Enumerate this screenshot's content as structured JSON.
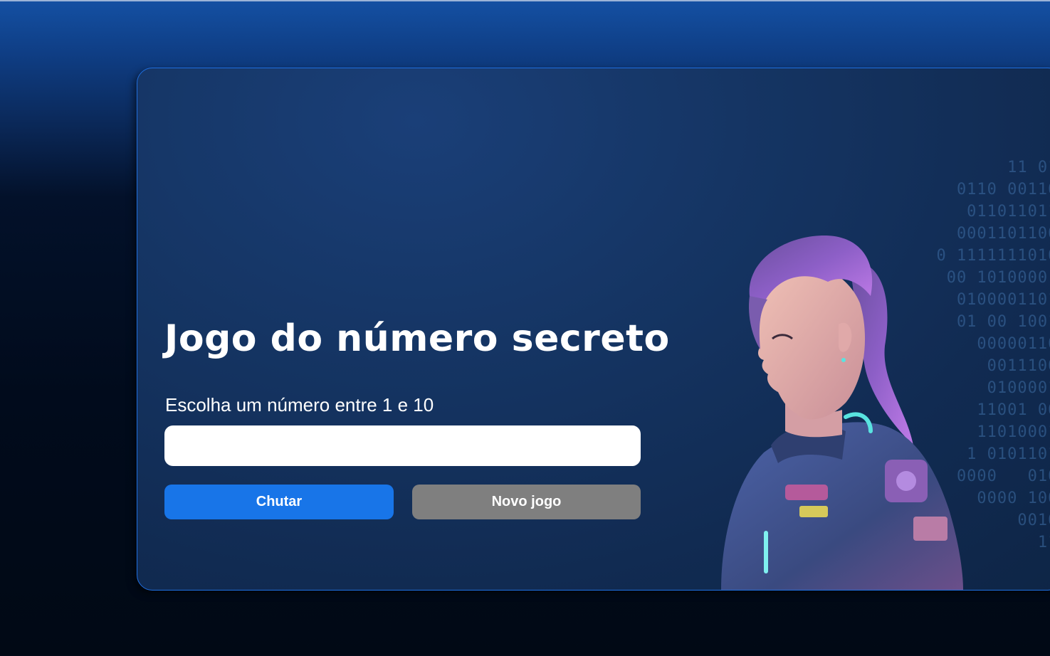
{
  "page": {
    "title": "Jogo do número secreto",
    "prompt": "Escolha um número entre 1 e 10"
  },
  "input": {
    "value": "",
    "placeholder": ""
  },
  "buttons": {
    "guess_label": "Chutar",
    "new_game_label": "Novo jogo"
  },
  "colors": {
    "card_border": "#1f6fe0",
    "primary_button": "#1875e8",
    "secondary_button": "#7f7f7f",
    "text": "#ffffff"
  },
  "icons": {
    "illustration": "astronaut-girl-illustration"
  }
}
